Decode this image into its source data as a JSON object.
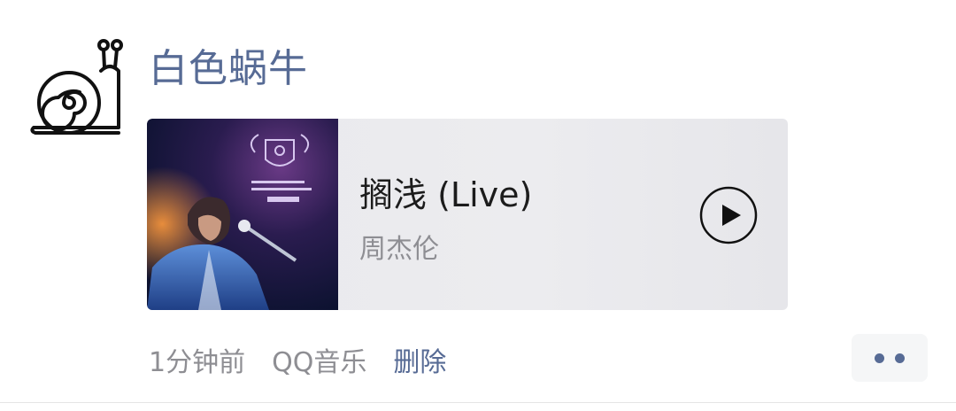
{
  "post": {
    "author": "白色蜗牛",
    "avatar_icon": "snail-icon",
    "music": {
      "title": "搁浅 (Live)",
      "artist": "周杰伦",
      "play_icon": "play-icon"
    },
    "timestamp": "1分钟前",
    "source": "QQ音乐",
    "delete_label": "删除",
    "more_icon": "more-dots-icon"
  },
  "colors": {
    "name_link": "#576b95",
    "meta_text": "#8e8e93",
    "card_bg": "#ececef"
  }
}
